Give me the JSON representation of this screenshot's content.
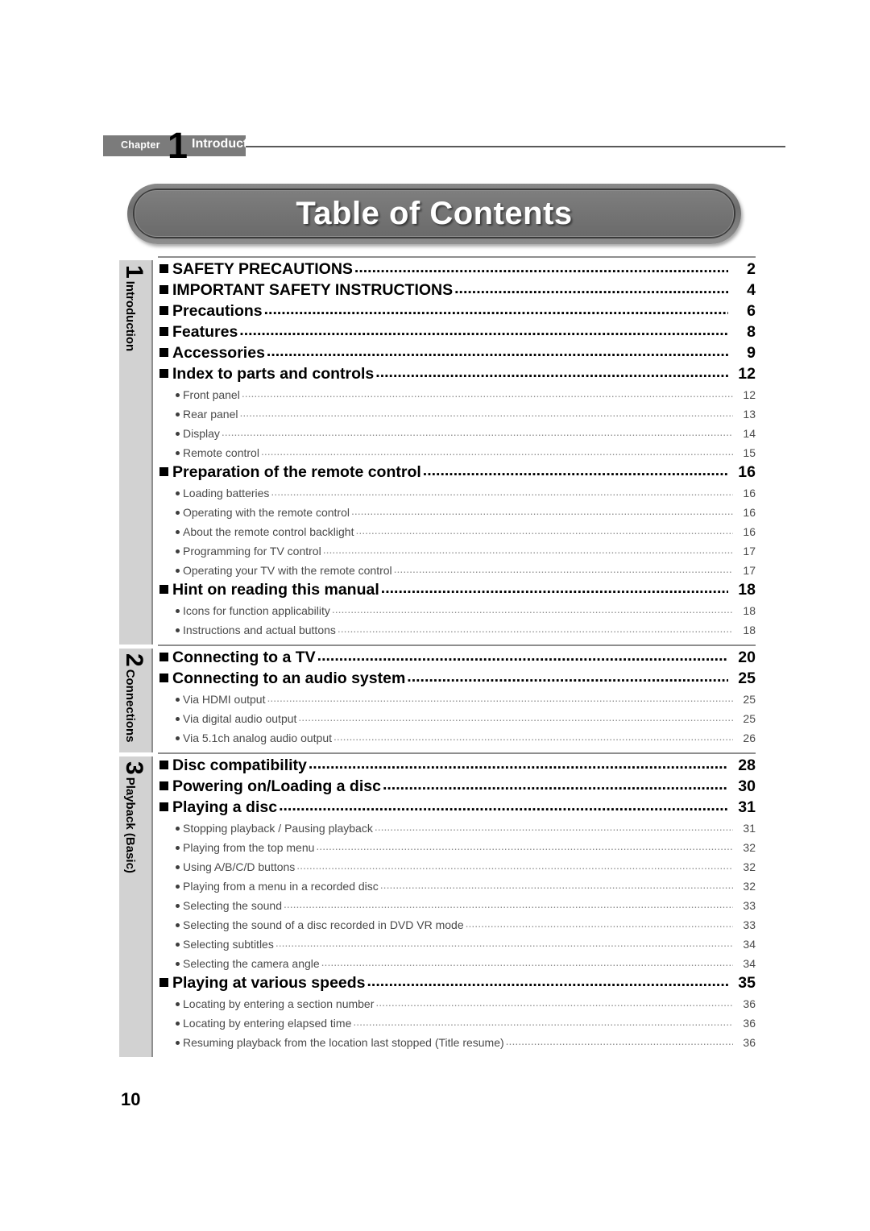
{
  "header": {
    "chapter_word": "Chapter",
    "chapter_number": "1",
    "chapter_name": "Introduction"
  },
  "title": "Table of Contents",
  "page_number": "10",
  "colors": {
    "tab_background": "#d2d2d2",
    "rule": "#8e8e8e",
    "header_bar": "#7b7b7b",
    "banner": "#737373",
    "minor_text": "#4a4a4a"
  },
  "chapters": [
    {
      "number": "1",
      "label": "Introduction",
      "entries": [
        {
          "level": "major",
          "text": "SAFETY PRECAUTIONS",
          "page": "2"
        },
        {
          "level": "major",
          "text": "IMPORTANT SAFETY INSTRUCTIONS",
          "page": "4"
        },
        {
          "level": "major",
          "text": "Precautions",
          "page": "6"
        },
        {
          "level": "major",
          "text": "Features",
          "page": "8"
        },
        {
          "level": "major",
          "text": "Accessories",
          "page": "9"
        },
        {
          "level": "major",
          "text": "Index to parts and controls",
          "page": "12"
        },
        {
          "level": "minor",
          "text": "Front panel",
          "page": "12"
        },
        {
          "level": "minor",
          "text": "Rear panel",
          "page": "13"
        },
        {
          "level": "minor",
          "text": "Display",
          "page": "14"
        },
        {
          "level": "minor",
          "text": "Remote control",
          "page": "15"
        },
        {
          "level": "major",
          "text": "Preparation of the remote control",
          "page": "16"
        },
        {
          "level": "minor",
          "text": "Loading batteries",
          "page": "16"
        },
        {
          "level": "minor",
          "text": "Operating with the remote control",
          "page": "16"
        },
        {
          "level": "minor",
          "text": "About the remote control backlight",
          "page": "16"
        },
        {
          "level": "minor",
          "text": "Programming for TV control",
          "page": "17"
        },
        {
          "level": "minor",
          "text": "Operating your TV with the remote control",
          "page": "17"
        },
        {
          "level": "major",
          "text": "Hint on reading this manual",
          "page": "18"
        },
        {
          "level": "minor",
          "text": "Icons for function applicability",
          "page": "18"
        },
        {
          "level": "minor",
          "text": "Instructions and actual buttons",
          "page": "18"
        }
      ]
    },
    {
      "number": "2",
      "label": "Connections",
      "entries": [
        {
          "level": "major",
          "text": "Connecting to a TV",
          "page": "20"
        },
        {
          "level": "major",
          "text": "Connecting to an audio system",
          "page": "25"
        },
        {
          "level": "minor",
          "text": "Via HDMI output",
          "page": "25"
        },
        {
          "level": "minor",
          "text": "Via digital audio output",
          "page": "25"
        },
        {
          "level": "minor",
          "text": "Via 5.1ch analog audio output",
          "page": "26"
        }
      ]
    },
    {
      "number": "3",
      "label": "Playback (Basic)",
      "entries": [
        {
          "level": "major",
          "text": "Disc compatibility",
          "page": "28"
        },
        {
          "level": "major",
          "text": "Powering on/Loading a disc",
          "page": "30"
        },
        {
          "level": "major",
          "text": "Playing a disc",
          "page": "31"
        },
        {
          "level": "minor",
          "text": "Stopping playback / Pausing playback",
          "page": "31"
        },
        {
          "level": "minor",
          "text": "Playing from the top menu",
          "page": "32"
        },
        {
          "level": "minor",
          "text": "Using A/B/C/D buttons",
          "page": "32"
        },
        {
          "level": "minor",
          "text": "Playing from a menu in a recorded disc",
          "page": "32"
        },
        {
          "level": "minor",
          "text": "Selecting the sound",
          "page": "33"
        },
        {
          "level": "minor",
          "text": "Selecting the sound of a disc recorded in DVD VR mode",
          "page": "33"
        },
        {
          "level": "minor",
          "text": "Selecting subtitles",
          "page": "34"
        },
        {
          "level": "minor",
          "text": "Selecting the camera angle",
          "page": "34"
        },
        {
          "level": "major",
          "text": "Playing at various speeds",
          "page": "35"
        },
        {
          "level": "minor",
          "text": "Locating by entering a section number",
          "page": "36"
        },
        {
          "level": "minor",
          "text": "Locating by entering elapsed time",
          "page": "36"
        },
        {
          "level": "minor",
          "text": "Resuming playback from the location last stopped (Title resume)",
          "page": "36"
        }
      ]
    }
  ]
}
